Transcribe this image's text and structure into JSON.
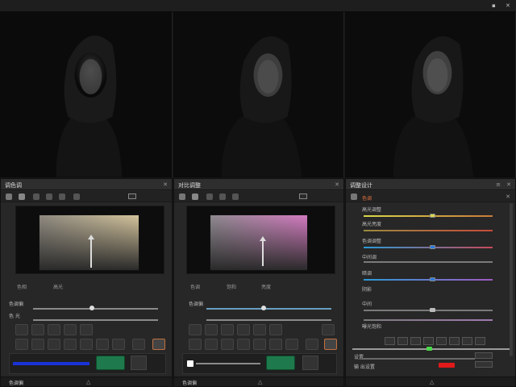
{
  "window": {
    "minimize_glyph": "▪",
    "close_glyph": "✕"
  },
  "views": [
    {
      "name": "view-1"
    },
    {
      "name": "view-2"
    },
    {
      "name": "view-3"
    }
  ],
  "panel1": {
    "title": "调色调",
    "tabs": [
      "色相",
      "高光"
    ],
    "row1_label": "色调偏",
    "row2_label": "色 光",
    "bottom_label": "色调偏",
    "gradient_colors": [
      "#d4c49c",
      "#8f8a80",
      "#2a2a2a"
    ],
    "accent": "#1a33d8"
  },
  "panel2": {
    "title": "对比调整",
    "tabs": [
      "色调",
      "饱和",
      "亮度"
    ],
    "row1_label": "色调偏",
    "bottom_label": "色调偏",
    "gradient_colors": [
      "#d47ac0",
      "#8f8a90",
      "#2a2a2a"
    ],
    "accent": "#1e7a4c"
  },
  "panel3": {
    "title": "调整设计",
    "header_tag": "色调",
    "rows": [
      "高光调整",
      "高光亮度",
      "色调调整",
      "中间调",
      "暗调",
      "阴影",
      "中间",
      "曝光饱和"
    ],
    "bottom_rows": [
      "设置",
      "输 出设置"
    ],
    "accent_red": "#e01a1a",
    "accent_blue": "#2a7be0",
    "accent_yellow": "#d8d84a"
  }
}
